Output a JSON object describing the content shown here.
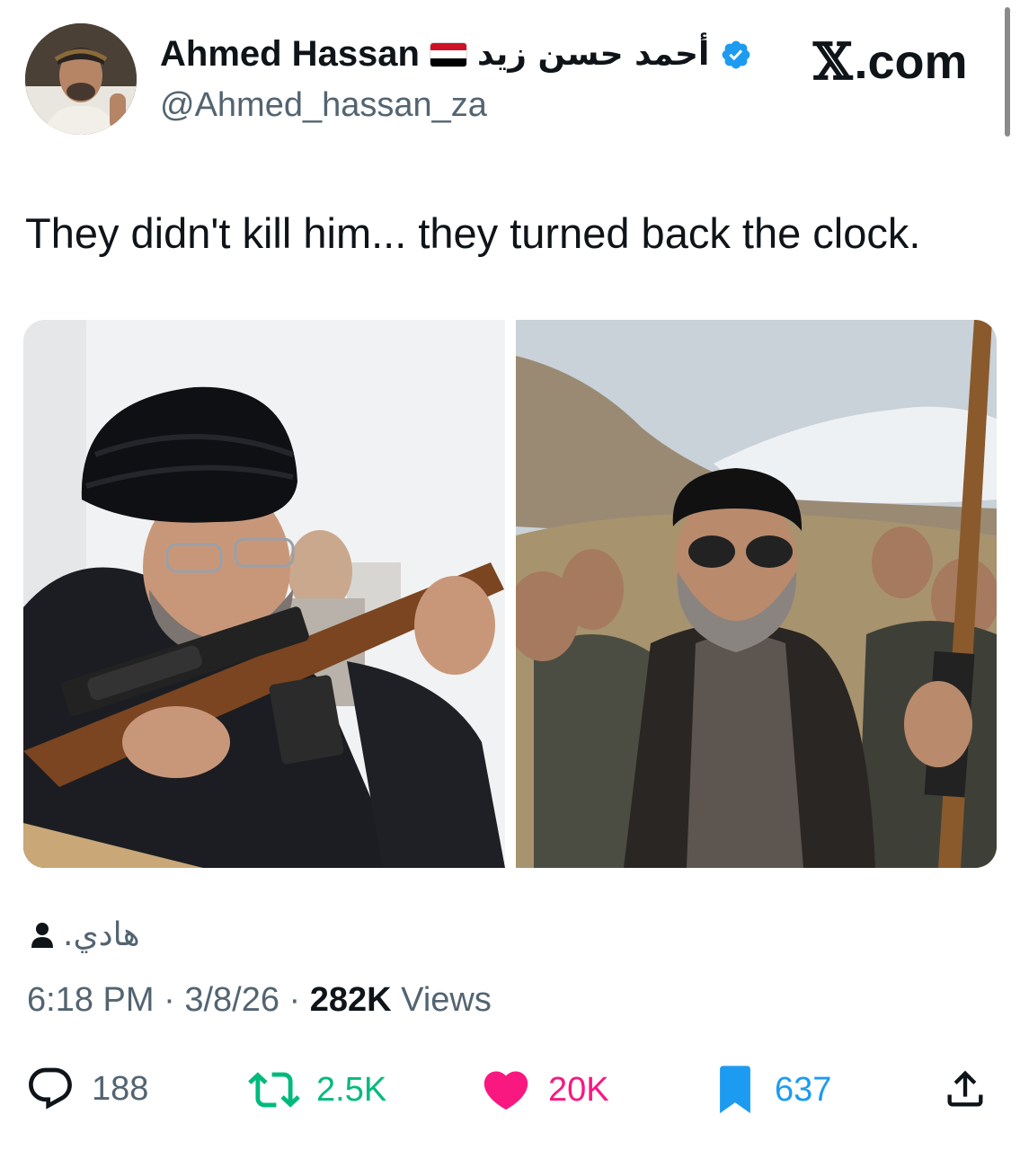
{
  "author": {
    "display_name": "Ahmed Hassan",
    "arabic_name": "أحمد حسن زيد",
    "handle": "@Ahmed_hassan_za",
    "flag": "yemen-flag",
    "verified": true
  },
  "site": {
    "label": ".com",
    "mark": "𝕏"
  },
  "tweet": {
    "text": "They didn't kill him... they turned back the clock."
  },
  "location": {
    "text": "هادي.",
    "icon": "person-icon"
  },
  "meta": {
    "time": "6:18 PM",
    "separator": "·",
    "date": "3/8/26",
    "views_count": "282K",
    "views_label": "Views"
  },
  "actions": {
    "replies": "188",
    "reposts": "2.5K",
    "likes": "20K",
    "bookmarks": "637"
  },
  "colors": {
    "repost": "#00ba7c",
    "like": "#f91880",
    "bookmark": "#1d9bf0",
    "verified": "#1d9bf0",
    "muted": "#536471"
  }
}
